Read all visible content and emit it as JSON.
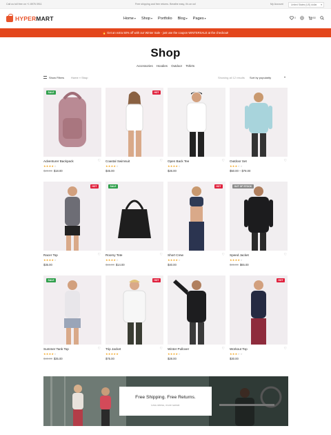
{
  "topbar": {
    "phone": "Call us toll free on +1 8976 0911",
    "notice": "Free shipping and free returns. Breathe easy, it's on us!",
    "account": "My Account",
    "currency": "United States (US) dollar"
  },
  "header": {
    "logo_prefix": "HYPER",
    "logo_suffix": "MART",
    "nav": [
      {
        "label": "Home",
        "caret": "▾"
      },
      {
        "label": "Shop",
        "caret": "▾"
      },
      {
        "label": "Portfolio",
        "caret": ""
      },
      {
        "label": "Blog",
        "caret": "▾"
      },
      {
        "label": "Pages",
        "caret": "▾"
      }
    ],
    "wishlist_count": "0",
    "cart_count": "$0",
    "icons": [
      "heart-icon",
      "compare-icon",
      "cart-icon",
      "search-icon"
    ]
  },
  "promo": {
    "icon": "🔥",
    "text": "Get an extra 50% off with our Winter Sale - just use the coupon WINTERSALE at the checkout!"
  },
  "page": {
    "title": "Shop",
    "categories": [
      "Accessories",
      "Hoodies",
      "Outdoor",
      "Tshirts"
    ]
  },
  "toolbar": {
    "filters_label": "Show Filters",
    "breadcrumb": "Home » Shop",
    "results": "Showing all 12 results",
    "sort_label": "Sort by popularity"
  },
  "colors": {
    "accent": "#e3461c",
    "sale": "#2e9e4a",
    "hot": "#e0203c",
    "stock": "#8a8a8a",
    "star": "#f1a21a"
  },
  "products": [
    {
      "name": "Adventurer Backpack",
      "badge": "SALE",
      "badge_color": "#2e9e4a",
      "badge_side": "left",
      "old_price": "$20.00",
      "price": "$18.00",
      "rating": 4
    },
    {
      "name": "Coastal Swimsuit",
      "badge": "HOT",
      "badge_color": "#e0203c",
      "badge_side": "right",
      "old_price": "",
      "price": "$45.00",
      "rating": 4
    },
    {
      "name": "Open Back Tee",
      "badge": "",
      "badge_color": "",
      "badge_side": "",
      "old_price": "",
      "price": "$26.00",
      "rating": 4
    },
    {
      "name": "Outdoor Set",
      "badge": "",
      "badge_color": "",
      "badge_side": "",
      "old_price": "",
      "price": "$50.00 – $78.00",
      "rating": 3
    },
    {
      "name": "Racer Top",
      "badge": "HOT",
      "badge_color": "#e0203c",
      "badge_side": "right",
      "old_price": "",
      "price": "$35.00",
      "rating": 4
    },
    {
      "name": "Roomy Tote",
      "badge": "SALE",
      "badge_color": "#2e9e4a",
      "badge_side": "left",
      "old_price": "$16.00",
      "price": "$14.00",
      "rating": 4
    },
    {
      "name": "Short Crew",
      "badge": "HOT",
      "badge_color": "#e0203c",
      "badge_side": "right",
      "old_price": "",
      "price": "$40.00",
      "rating": 4
    },
    {
      "name": "Speed Jacket",
      "badge": "OUT OF STOCK",
      "badge_color": "#8a8a8a",
      "badge_side": "left",
      "old_price": "$85.00",
      "price": "$65.00",
      "rating": 4
    },
    {
      "name": "Summer Tank Top",
      "badge": "SALE",
      "badge_color": "#2e9e4a",
      "badge_side": "left",
      "old_price": "$40.00",
      "price": "$35.00",
      "rating": 4
    },
    {
      "name": "Trip Jacket",
      "badge": "HOT",
      "badge_color": "#e0203c",
      "badge_side": "right",
      "old_price": "",
      "price": "$75.00",
      "rating": 5
    },
    {
      "name": "Winter Pullover",
      "badge": "",
      "badge_color": "",
      "badge_side": "",
      "old_price": "",
      "price": "$28.00",
      "rating": 4
    },
    {
      "name": "Workout Top",
      "badge": "HOT",
      "badge_color": "#e0203c",
      "badge_side": "right",
      "old_price": "",
      "price": "$30.00",
      "rating": 3
    }
  ],
  "banner": {
    "heading": "Free Shipping. Free Returns.",
    "sub": "Less stress, more sweat."
  }
}
